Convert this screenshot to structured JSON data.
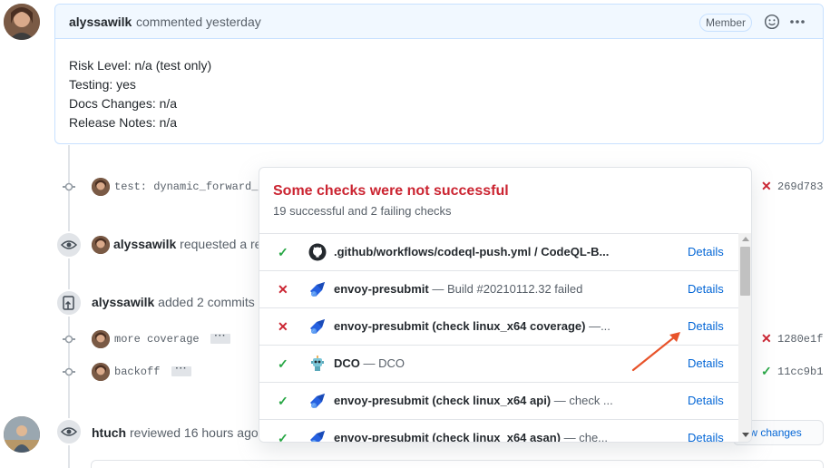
{
  "comment": {
    "author": "alyssawilk",
    "action": "commented yesterday",
    "badge": "Member",
    "body": [
      "Risk Level: n/a (test only)",
      "Testing: yes",
      "Docs Changes: n/a",
      "Release Notes: n/a"
    ]
  },
  "timeline": {
    "commit1": {
      "message": "test: dynamic_forward_",
      "sha": "269d783"
    },
    "review_request": {
      "actor": "alyssawilk",
      "text": "requested a re"
    },
    "added_commits": {
      "actor": "alyssawilk",
      "text": "added 2 commits"
    },
    "commit2": {
      "message": "more coverage",
      "ellipsis": "···",
      "sha": "1280e1f"
    },
    "commit3": {
      "message": "backoff",
      "ellipsis": "···",
      "sha": "11cc9b1"
    },
    "review": {
      "actor": "htuch",
      "text": "reviewed 16 hours ago"
    },
    "view_changes": "iew changes"
  },
  "checks_popover": {
    "title": "Some checks were not successful",
    "subtitle": "19 successful and 2 failing checks",
    "details_label": "Details",
    "rows": [
      {
        "status": "success",
        "icon": "github-icon",
        "name": ".github/workflows/codeql-push.yml / CodeQL-B...",
        "description": ""
      },
      {
        "status": "failure",
        "icon": "azure-pipelines-icon",
        "name": "envoy-presubmit",
        "description": " — Build #20210112.32 failed"
      },
      {
        "status": "failure",
        "icon": "azure-pipelines-icon",
        "name": "envoy-presubmit (check linux_x64 coverage)",
        "description": " —..."
      },
      {
        "status": "success",
        "icon": "dco-robot-icon",
        "name": "DCO",
        "description": " — DCO"
      },
      {
        "status": "success",
        "icon": "azure-pipelines-icon",
        "name": "envoy-presubmit (check linux_x64 api)",
        "description": " — check ..."
      },
      {
        "status": "success",
        "icon": "azure-pipelines-icon",
        "name": "envoy-presubmit (check linux_x64 asan)",
        "description": " — che..."
      }
    ]
  },
  "colors": {
    "failure": "#cb2431",
    "success": "#28a745",
    "link": "#0366d6",
    "annotation_arrow": "#e8532a"
  }
}
